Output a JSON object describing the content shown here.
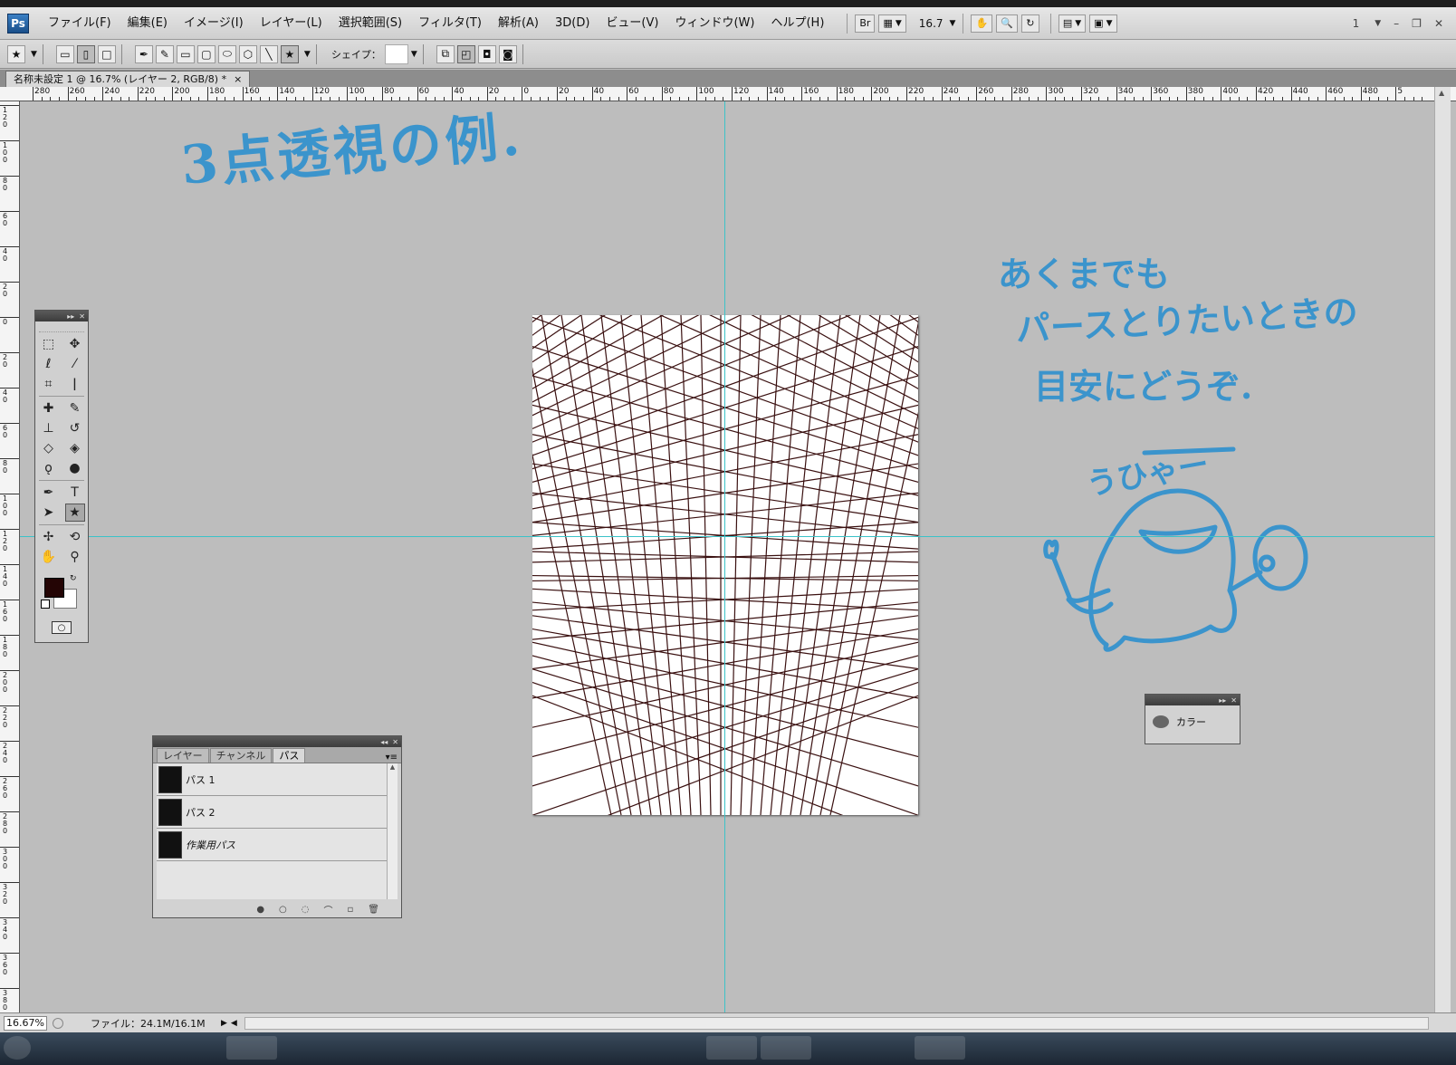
{
  "app": {
    "logo": "Ps"
  },
  "menu": {
    "items": [
      "ファイル(F)",
      "編集(E)",
      "イメージ(I)",
      "レイヤー(L)",
      "選択範囲(S)",
      "フィルタ(T)",
      "解析(A)",
      "3D(D)",
      "ビュー(V)",
      "ウィンドウ(W)",
      "ヘルプ(H)"
    ],
    "bridge_label": "Br",
    "zoom_value": "16.7",
    "workspace_value": "1"
  },
  "options": {
    "shape_label": "シェイプ："
  },
  "document": {
    "tab_title": "名称未設定 1 @ 16.7% (レイヤー 2, RGB/8) *",
    "close": "×"
  },
  "rulers": {
    "horizontal": [
      "280",
      "260",
      "240",
      "220",
      "200",
      "180",
      "160",
      "140",
      "120",
      "100",
      "80",
      "60",
      "40",
      "20",
      "0",
      "20",
      "40",
      "60",
      "80",
      "100",
      "120",
      "140",
      "160",
      "180",
      "200",
      "220",
      "240",
      "260",
      "280",
      "300",
      "320",
      "340",
      "360",
      "380",
      "400",
      "420",
      "440",
      "460",
      "480",
      "5"
    ],
    "vertical": [
      "1 2 0",
      "1 0 0",
      "8 0",
      "6 0",
      "4 0",
      "2 0",
      "0",
      "2 0",
      "4 0",
      "6 0",
      "8 0",
      "1 0 0",
      "1 2 0",
      "1 4 0",
      "1 6 0",
      "1 8 0",
      "2 0 0",
      "2 2 0",
      "2 4 0",
      "2 6 0",
      "2 8 0",
      "3 0 0",
      "3 2 0",
      "3 4 0",
      "3 6 0",
      "3 8 0"
    ]
  },
  "canvas": {
    "handwriting_title": "3点透視の例.",
    "handwriting_note": [
      "あくまでも",
      "パースとりたいときの",
      "目安にどうぞ."
    ],
    "handwriting_cry": "うひゃー",
    "ink_color": "#3b94cc",
    "grid_line_color": "#3a1010",
    "guide_color": "#3cc3c8"
  },
  "toolbox": {
    "foreground_color": "#240505",
    "background_color": "#ffffff",
    "tools": [
      "marquee-icon",
      "move-icon",
      "lasso-icon",
      "magic-wand-icon",
      "crop-icon",
      "eyedropper-icon",
      "healing-brush-icon",
      "brush-icon",
      "clone-stamp-icon",
      "history-brush-icon",
      "eraser-icon",
      "paint-bucket-icon",
      "dodge-icon",
      "sponge-icon",
      "pen-icon",
      "type-icon",
      "path-select-icon",
      "custom-shape-icon",
      "3d-rotate-icon",
      "3d-orbit-icon",
      "hand-icon",
      "zoom-icon"
    ]
  },
  "paths_panel": {
    "tabs": [
      "レイヤー",
      "チャンネル",
      "パス"
    ],
    "active_tab": "パス",
    "paths": [
      {
        "name": "パス 1",
        "italic": false
      },
      {
        "name": "パス 2",
        "italic": false
      },
      {
        "name": "作業用パス",
        "italic": true
      }
    ]
  },
  "color_panel": {
    "label": "カラー"
  },
  "status": {
    "zoom": "16.67%",
    "file_info": "ファイル：24.1M/16.1M"
  }
}
